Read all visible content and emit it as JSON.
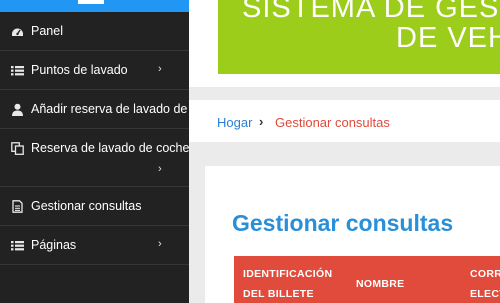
{
  "sidebar": {
    "items": [
      {
        "label": "Panel",
        "icon": "dashboard-icon",
        "has_submenu": false
      },
      {
        "label": "Puntos de lavado",
        "icon": "list-icon",
        "has_submenu": true
      },
      {
        "label": "Añadir reserva de lavado de auto",
        "icon": "user-icon",
        "has_submenu": false
      },
      {
        "label": "Reserva de lavado de coches",
        "icon": "copy-icon",
        "has_submenu": true
      },
      {
        "label": "Gestionar consultas",
        "icon": "document-icon",
        "has_submenu": false
      },
      {
        "label": "Páginas",
        "icon": "list-icon",
        "has_submenu": true
      }
    ],
    "chevron": "›"
  },
  "banner": {
    "line1": "SISTEMA DE GES",
    "line2": "DE VEH"
  },
  "breadcrumb": {
    "home": "Hogar",
    "separator": "›",
    "current": "Gestionar consultas"
  },
  "main": {
    "title": "Gestionar consultas",
    "table": {
      "headers": [
        "IDENTIFICACIÓN DEL BILLETE",
        "NOMBRE",
        "CORREO ELECTRÓNICO"
      ],
      "header_lines": [
        [
          "IDENTIFICACIÓN",
          "DEL BILLETE"
        ],
        [
          "NOMBRE"
        ],
        [
          "CORR",
          "ELECT"
        ]
      ]
    }
  },
  "colors": {
    "sidebar_bg": "#222222",
    "accent_blue": "#2196f3",
    "banner_green": "#9ccd1b",
    "link_blue": "#2a7fd4",
    "title_blue": "#2a8fd9",
    "header_red": "#e04b3c"
  }
}
